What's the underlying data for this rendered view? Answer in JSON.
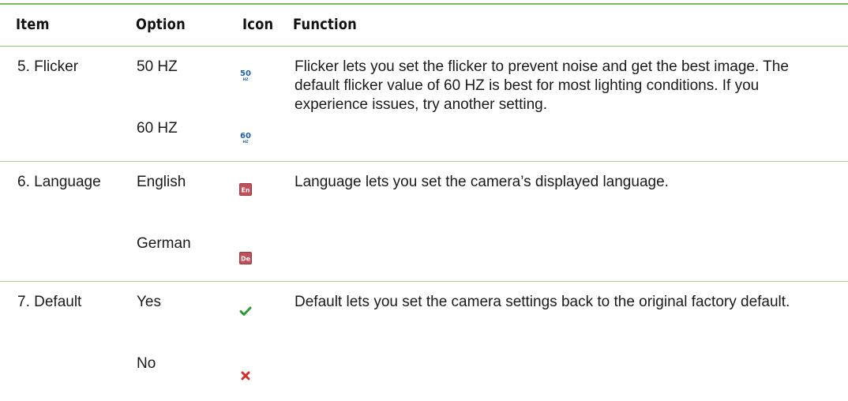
{
  "header": {
    "item": "Item",
    "option": "Option",
    "icon": "Icon",
    "function": "Function"
  },
  "rows": [
    {
      "item": "5. Flicker",
      "options": [
        {
          "label": "50 HZ",
          "icon": "flicker-50hz-icon",
          "icon_text": "50",
          "icon_sub": "HZ",
          "color": "#1f5fa8"
        },
        {
          "label": "60 HZ",
          "icon": "flicker-60hz-icon",
          "icon_text": "60",
          "icon_sub": "HZ",
          "color": "#1f5fa8"
        }
      ],
      "function": "Flicker lets you set the flicker to prevent noise and get the best image. The default flicker value of 60 HZ is best for most lighting conditions. If you experience issues, try another setting."
    },
    {
      "item": "6. Language",
      "options": [
        {
          "label": "English",
          "icon": "english-language-icon",
          "icon_text": "En",
          "color": "#c2505a"
        },
        {
          "label": "German",
          "icon": "german-language-icon",
          "icon_text": "De",
          "color": "#c2505a"
        }
      ],
      "function": "Language lets you set the camera’s displayed language."
    },
    {
      "item": "7. Default",
      "options": [
        {
          "label": "Yes",
          "icon": "checkmark-icon",
          "color": "#2e9b3a"
        },
        {
          "label": "No",
          "icon": "cross-icon",
          "color": "#d0322a"
        }
      ],
      "function": "Default lets you set the camera settings back to the original factory default."
    }
  ]
}
